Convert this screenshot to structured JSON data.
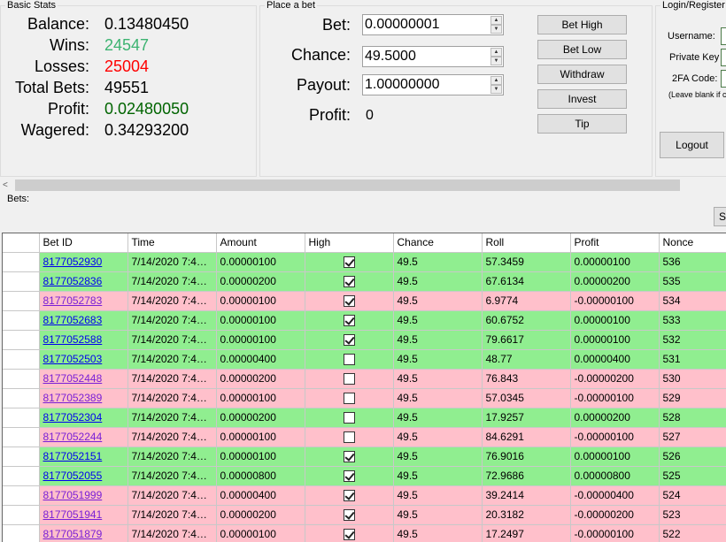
{
  "basic_stats": {
    "title": "Basic Stats",
    "rows": [
      {
        "label": "Balance:",
        "value": "0.13480450",
        "color": "#000000"
      },
      {
        "label": "Wins:",
        "value": "24547",
        "color": "#3cb371"
      },
      {
        "label": "Losses:",
        "value": "25004",
        "color": "#ff0000"
      },
      {
        "label": "Total Bets:",
        "value": "49551",
        "color": "#000000"
      },
      {
        "label": "Profit:",
        "value": "0.02480050",
        "color": "#006400"
      },
      {
        "label": "Wagered:",
        "value": "0.34293200",
        "color": "#000000"
      }
    ]
  },
  "place_bet": {
    "title": "Place a bet",
    "bet_label": "Bet:",
    "bet_value": "0.00000001",
    "chance_label": "Chance:",
    "chance_value": "49.5000",
    "payout_label": "Payout:",
    "payout_value": "1.00000000",
    "profit_label": "Profit:",
    "profit_value": "0",
    "buttons": {
      "bet_high": "Bet High",
      "bet_low": "Bet Low",
      "withdraw": "Withdraw",
      "invest": "Invest",
      "tip": "Tip"
    }
  },
  "login": {
    "title": "Login/Register",
    "username_label": "Username:",
    "private_key_label": "Private Key",
    "twofa_label": "2FA Code:",
    "twofa_note": "(Leave blank if c",
    "logout_button": "Logout"
  },
  "bets_label": "Bets:",
  "corner_button": "S",
  "columns": [
    "Bet ID",
    "Time",
    "Amount",
    "High",
    "Chance",
    "Roll",
    "Profit",
    "Nonce"
  ],
  "bets": [
    {
      "id": "8177052930",
      "time": "7/14/2020 7:40:...",
      "amount": "0.00000100",
      "high": true,
      "chance": "49.5",
      "roll": "57.3459",
      "profit": "0.00000100",
      "nonce": "536",
      "win": true,
      "visited": false
    },
    {
      "id": "8177052836",
      "time": "7/14/2020 7:40:...",
      "amount": "0.00000200",
      "high": true,
      "chance": "49.5",
      "roll": "67.6134",
      "profit": "0.00000200",
      "nonce": "535",
      "win": true,
      "visited": false
    },
    {
      "id": "8177052783",
      "time": "7/14/2020 7:40:...",
      "amount": "0.00000100",
      "high": true,
      "chance": "49.5",
      "roll": "6.9774",
      "profit": "-0.00000100",
      "nonce": "534",
      "win": false,
      "visited": true
    },
    {
      "id": "8177052683",
      "time": "7/14/2020 7:40:...",
      "amount": "0.00000100",
      "high": true,
      "chance": "49.5",
      "roll": "60.6752",
      "profit": "0.00000100",
      "nonce": "533",
      "win": true,
      "visited": false
    },
    {
      "id": "8177052588",
      "time": "7/14/2020 7:40:...",
      "amount": "0.00000100",
      "high": true,
      "chance": "49.5",
      "roll": "79.6617",
      "profit": "0.00000100",
      "nonce": "532",
      "win": true,
      "visited": false
    },
    {
      "id": "8177052503",
      "time": "7/14/2020 7:40:...",
      "amount": "0.00000400",
      "high": false,
      "chance": "49.5",
      "roll": "48.77",
      "profit": "0.00000400",
      "nonce": "531",
      "win": true,
      "visited": false
    },
    {
      "id": "8177052448",
      "time": "7/14/2020 7:40:...",
      "amount": "0.00000200",
      "high": false,
      "chance": "49.5",
      "roll": "76.843",
      "profit": "-0.00000200",
      "nonce": "530",
      "win": false,
      "visited": true
    },
    {
      "id": "8177052389",
      "time": "7/14/2020 7:40:...",
      "amount": "0.00000100",
      "high": false,
      "chance": "49.5",
      "roll": "57.0345",
      "profit": "-0.00000100",
      "nonce": "529",
      "win": false,
      "visited": true
    },
    {
      "id": "8177052304",
      "time": "7/14/2020 7:40:...",
      "amount": "0.00000200",
      "high": false,
      "chance": "49.5",
      "roll": "17.9257",
      "profit": "0.00000200",
      "nonce": "528",
      "win": true,
      "visited": false
    },
    {
      "id": "8177052244",
      "time": "7/14/2020 7:40:...",
      "amount": "0.00000100",
      "high": false,
      "chance": "49.5",
      "roll": "84.6291",
      "profit": "-0.00000100",
      "nonce": "527",
      "win": false,
      "visited": true
    },
    {
      "id": "8177052151",
      "time": "7/14/2020 7:40:...",
      "amount": "0.00000100",
      "high": true,
      "chance": "49.5",
      "roll": "76.9016",
      "profit": "0.00000100",
      "nonce": "526",
      "win": true,
      "visited": false
    },
    {
      "id": "8177052055",
      "time": "7/14/2020 7:40:...",
      "amount": "0.00000800",
      "high": true,
      "chance": "49.5",
      "roll": "72.9686",
      "profit": "0.00000800",
      "nonce": "525",
      "win": true,
      "visited": false
    },
    {
      "id": "8177051999",
      "time": "7/14/2020 7:40:...",
      "amount": "0.00000400",
      "high": true,
      "chance": "49.5",
      "roll": "39.2414",
      "profit": "-0.00000400",
      "nonce": "524",
      "win": false,
      "visited": true
    },
    {
      "id": "8177051941",
      "time": "7/14/2020 7:40:...",
      "amount": "0.00000200",
      "high": true,
      "chance": "49.5",
      "roll": "20.3182",
      "profit": "-0.00000200",
      "nonce": "523",
      "win": false,
      "visited": true
    },
    {
      "id": "8177051879",
      "time": "7/14/2020 7:40:...",
      "amount": "0.00000100",
      "high": true,
      "chance": "49.5",
      "roll": "17.2497",
      "profit": "-0.00000100",
      "nonce": "522",
      "win": false,
      "visited": true
    }
  ],
  "colors": {
    "win_row": "#90ee90",
    "loss_row": "#ffc0cb",
    "link": "#0000ee",
    "visited_link": "#7a1fd6"
  }
}
